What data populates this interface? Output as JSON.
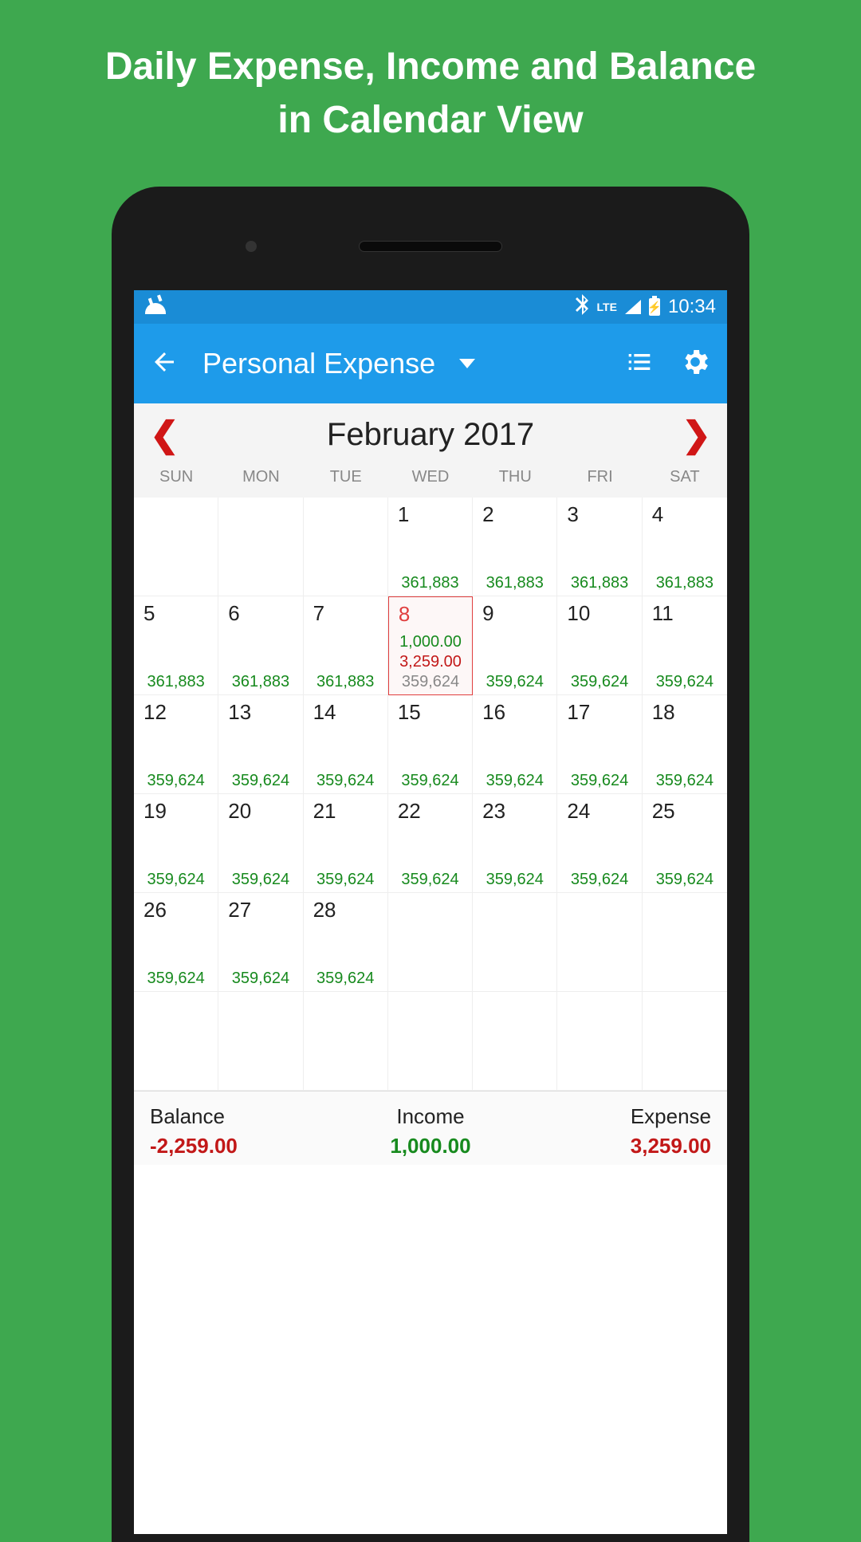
{
  "promo": {
    "line1": "Daily Expense, Income and Balance",
    "line2": "in Calendar View"
  },
  "statusbar": {
    "lte": "LTE",
    "time": "10:34"
  },
  "appbar": {
    "title": "Personal Expense"
  },
  "month": {
    "title": "February 2017"
  },
  "weekdays": [
    "SUN",
    "MON",
    "TUE",
    "WED",
    "THU",
    "FRI",
    "SAT"
  ],
  "days": [
    {
      "n": "",
      "b": ""
    },
    {
      "n": "",
      "b": ""
    },
    {
      "n": "",
      "b": ""
    },
    {
      "n": "1",
      "b": "361,883"
    },
    {
      "n": "2",
      "b": "361,883"
    },
    {
      "n": "3",
      "b": "361,883"
    },
    {
      "n": "4",
      "b": "361,883"
    },
    {
      "n": "5",
      "b": "361,883"
    },
    {
      "n": "6",
      "b": "361,883"
    },
    {
      "n": "7",
      "b": "361,883"
    },
    {
      "n": "8",
      "b": "359,624",
      "inc": "1,000.00",
      "exp": "3,259.00",
      "today": true
    },
    {
      "n": "9",
      "b": "359,624"
    },
    {
      "n": "10",
      "b": "359,624"
    },
    {
      "n": "11",
      "b": "359,624"
    },
    {
      "n": "12",
      "b": "359,624"
    },
    {
      "n": "13",
      "b": "359,624"
    },
    {
      "n": "14",
      "b": "359,624"
    },
    {
      "n": "15",
      "b": "359,624"
    },
    {
      "n": "16",
      "b": "359,624"
    },
    {
      "n": "17",
      "b": "359,624"
    },
    {
      "n": "18",
      "b": "359,624"
    },
    {
      "n": "19",
      "b": "359,624"
    },
    {
      "n": "20",
      "b": "359,624"
    },
    {
      "n": "21",
      "b": "359,624"
    },
    {
      "n": "22",
      "b": "359,624"
    },
    {
      "n": "23",
      "b": "359,624"
    },
    {
      "n": "24",
      "b": "359,624"
    },
    {
      "n": "25",
      "b": "359,624"
    },
    {
      "n": "26",
      "b": "359,624"
    },
    {
      "n": "27",
      "b": "359,624"
    },
    {
      "n": "28",
      "b": "359,624"
    },
    {
      "n": "",
      "b": ""
    },
    {
      "n": "",
      "b": ""
    },
    {
      "n": "",
      "b": ""
    },
    {
      "n": "",
      "b": ""
    },
    {
      "n": "",
      "b": ""
    },
    {
      "n": "",
      "b": ""
    },
    {
      "n": "",
      "b": ""
    },
    {
      "n": "",
      "b": ""
    },
    {
      "n": "",
      "b": ""
    },
    {
      "n": "",
      "b": ""
    },
    {
      "n": "",
      "b": ""
    }
  ],
  "summary": {
    "balance_label": "Balance",
    "balance_value": "-2,259.00",
    "income_label": "Income",
    "income_value": "1,000.00",
    "expense_label": "Expense",
    "expense_value": "3,259.00"
  }
}
